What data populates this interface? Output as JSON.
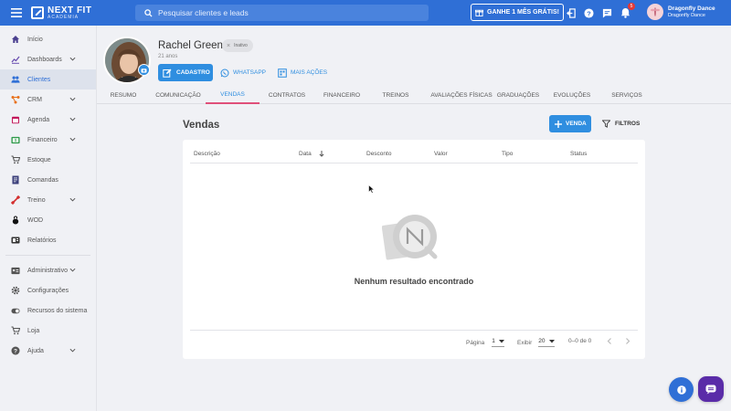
{
  "topbar": {
    "logo_title": "NEXT FIT",
    "logo_sub": "ACADEMIA",
    "search_placeholder": "Pesquisar clientes e leads",
    "promo_label": "GANHE 1 MÊS GRÁTIS!",
    "notification_count": "5",
    "user_name": "Dragonfly Dance",
    "user_company": "Dragonfly Dance"
  },
  "sidebar": {
    "items": [
      {
        "label": "Início",
        "icon": "home-icon"
      },
      {
        "label": "Dashboards",
        "icon": "chart-line-icon",
        "expandable": true
      },
      {
        "label": "Clientes",
        "icon": "people-icon",
        "active": true
      },
      {
        "label": "CRM",
        "icon": "crm-icon",
        "expandable": true
      },
      {
        "label": "Agenda",
        "icon": "calendar-icon",
        "expandable": true
      },
      {
        "label": "Financeiro",
        "icon": "money-icon",
        "expandable": true
      },
      {
        "label": "Estoque",
        "icon": "cart-icon"
      },
      {
        "label": "Comandas",
        "icon": "receipt-icon"
      },
      {
        "label": "Treino",
        "icon": "dumbbell-icon",
        "expandable": true
      },
      {
        "label": "WOD",
        "icon": "kettlebell-icon"
      },
      {
        "label": "Relatórios",
        "icon": "report-icon"
      }
    ],
    "bottom_items": [
      {
        "label": "Administrativo",
        "icon": "id-card-icon",
        "expandable": true
      },
      {
        "label": "Configurações",
        "icon": "gear-icon"
      },
      {
        "label": "Recursos do sistema",
        "icon": "toggle-icon"
      },
      {
        "label": "Loja",
        "icon": "cart-icon"
      },
      {
        "label": "Ajuda",
        "icon": "help-icon",
        "expandable": true
      }
    ]
  },
  "profile": {
    "name": "Rachel Green",
    "status": "Inativo",
    "age": "21 anos",
    "cadastro_label": "CADASTRO",
    "whatsapp_label": "WHATSAPP",
    "more_actions_label": "MAIS AÇÕES"
  },
  "tabs": [
    "RESUMO",
    "COMUNICAÇÃO",
    "VENDAS",
    "CONTRATOS",
    "FINANCEIRO",
    "TREINOS",
    "AVALIAÇÕES FÍSICAS",
    "GRADUAÇÕES",
    "EVOLUÇÕES",
    "SERVIÇOS"
  ],
  "active_tab": "VENDAS",
  "sales": {
    "title": "Vendas",
    "new_sale_label": "VENDA",
    "filters_label": "FILTROS",
    "columns": [
      "Descrição",
      "Data",
      "Desconto",
      "Valor",
      "Tipo",
      "Status"
    ],
    "empty_message": "Nenhum resultado encontrado",
    "pagination": {
      "page_label": "Página",
      "page_value": "1",
      "show_label": "Exibir",
      "show_value": "20",
      "range": "0–0 de 0"
    }
  },
  "colors": {
    "primary": "#2f6fd6",
    "accent": "#2f8ee0",
    "tab_underline": "#e0507a",
    "chat": "#5a2ca8"
  }
}
